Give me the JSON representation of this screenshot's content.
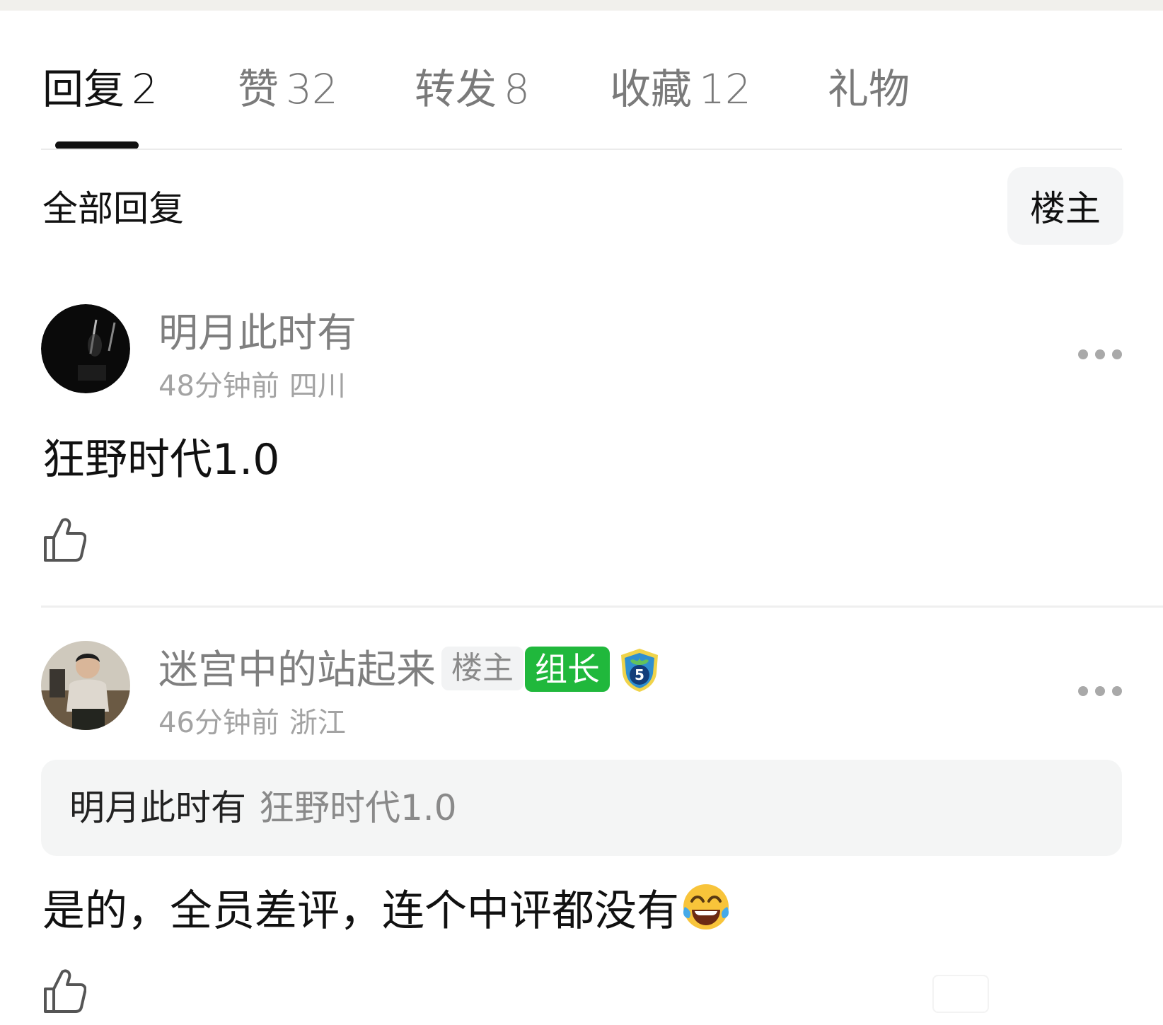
{
  "tabs": [
    {
      "label": "回复",
      "count": "2",
      "active": true
    },
    {
      "label": "赞",
      "count": "32",
      "active": false
    },
    {
      "label": "转发",
      "count": "8",
      "active": false
    },
    {
      "label": "收藏",
      "count": "12",
      "active": false
    },
    {
      "label": "礼物",
      "count": "",
      "active": false
    }
  ],
  "filter": {
    "title": "全部回复",
    "op_filter_label": "楼主"
  },
  "comments": [
    {
      "username": "明月此时有",
      "time": "48分钟前",
      "location": "四川",
      "content": "狂野时代1.0",
      "icons": {
        "avatar": "night-sky-avatar",
        "more": "more-dots-icon",
        "like": "thumbs-up-icon"
      }
    },
    {
      "username": "迷宫中的站起来",
      "badges": {
        "op": "楼主",
        "leader": "组长",
        "level": "5"
      },
      "time": "46分钟前",
      "location": "浙江",
      "quote": {
        "user": "明月此时有",
        "text": "狂野时代1.0"
      },
      "content": "是的，全员差评，连个中评都没有",
      "icons": {
        "avatar": "person-photo-avatar",
        "more": "more-dots-icon",
        "like": "thumbs-up-icon",
        "emoji": "tears-of-joy-emoji",
        "level": "shield-level-icon"
      }
    }
  ],
  "colors": {
    "accent_green": "#20b83c",
    "text_primary": "#111111",
    "text_secondary": "#7f7f7f",
    "text_meta": "#a3a3a3",
    "panel_bg": "#f4f5f5"
  }
}
